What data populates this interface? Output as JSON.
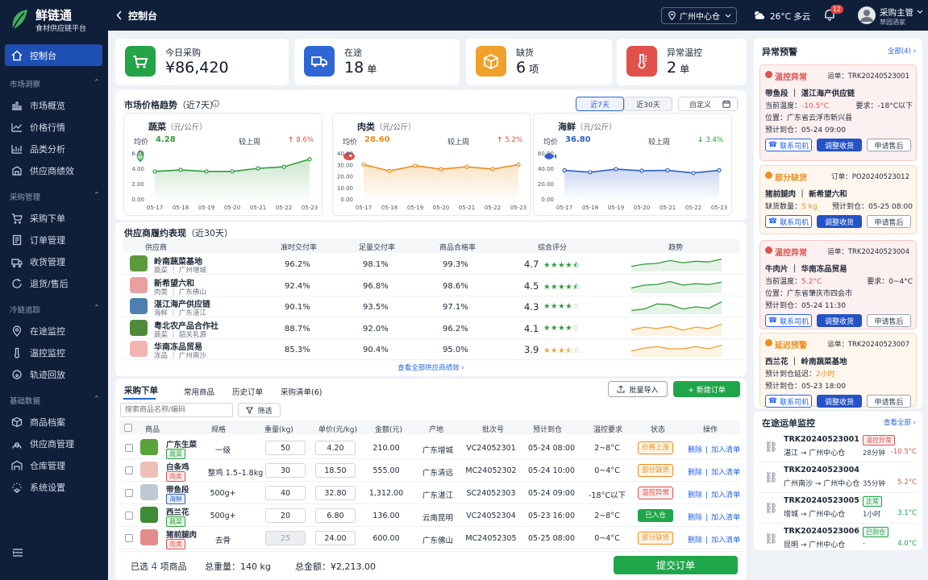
{
  "app": {
    "name": "鲜链通",
    "subtitle": "食材供应链平台"
  },
  "topbar": {
    "page_title": "控制台",
    "location": "广州中心仓",
    "weather": "26°C 多云",
    "notif_count": "12",
    "user_name": "采购主管",
    "user_org": "草园酒家"
  },
  "sidebar": {
    "home": "控制台",
    "groups": [
      {
        "title": "市场洞察",
        "items": [
          "市场概览",
          "价格行情",
          "品类分析",
          "供应商绩效"
        ]
      },
      {
        "title": "采购管理",
        "items": [
          "采购下单",
          "订单管理",
          "收货管理",
          "退货/售后"
        ]
      },
      {
        "title": "冷链追踪",
        "items": [
          "在途监控",
          "温控监控",
          "轨迹回放"
        ]
      },
      {
        "title": "基础数据",
        "items": [
          "商品档案",
          "供应商管理",
          "仓库管理",
          "系统设置"
        ]
      }
    ]
  },
  "kpis": [
    {
      "label": "今日采购",
      "value": "¥86,420",
      "unit": ""
    },
    {
      "label": "在途",
      "value": "18",
      "unit": "单"
    },
    {
      "label": "缺货",
      "value": "6",
      "unit": "项"
    },
    {
      "label": "异常温控",
      "value": "2",
      "unit": "单"
    }
  ],
  "price_trend": {
    "title": "市场价格趋势",
    "subtitle": "（近7天）",
    "tabs": [
      "近7天",
      "近30天"
    ],
    "custom": "自定义",
    "avg_label": "均价",
    "cmp_label": "较上周",
    "charts": [
      {
        "name": "蔬菜",
        "unit": "（元/公斤）",
        "avg": "4.28",
        "change": "8.6%",
        "dir": "up",
        "color": "#2e9b3b"
      },
      {
        "name": "肉类",
        "unit": "（元/公斤）",
        "avg": "28.60",
        "change": "5.2%",
        "dir": "up",
        "color": "#f08c1a"
      },
      {
        "name": "海鲜",
        "unit": "（元/公斤）",
        "avg": "36.80",
        "change": "3.4%",
        "dir": "down",
        "color": "#2f5fc8"
      }
    ]
  },
  "chart_data": [
    {
      "type": "line",
      "title": "蔬菜",
      "x": [
        "05-17",
        "05-18",
        "05-19",
        "05-20",
        "05-21",
        "05-22",
        "05-23"
      ],
      "values": [
        3.6,
        3.8,
        3.6,
        3.6,
        4.0,
        4.2,
        5.2
      ],
      "ylim": [
        0,
        6
      ],
      "yticks": [
        "6.00",
        "4.00",
        "2.00",
        "0.00"
      ]
    },
    {
      "type": "line",
      "title": "肉类",
      "x": [
        "05-17",
        "05-18",
        "05-19",
        "05-20",
        "05-21",
        "05-22",
        "05-23"
      ],
      "values": [
        30,
        24.5,
        29,
        26,
        28,
        26,
        30
      ],
      "ylim": [
        0,
        40
      ],
      "yticks": [
        "40.00",
        "30.00",
        "20.00",
        "10.00",
        "0.00"
      ]
    },
    {
      "type": "line",
      "title": "海鲜",
      "x": [
        "05-17",
        "05-18",
        "05-19",
        "05-20",
        "05-21",
        "05-22",
        "05-23"
      ],
      "values": [
        37.5,
        35,
        39,
        37,
        37.5,
        34,
        37.5
      ],
      "ylim": [
        0,
        60
      ],
      "yticks": [
        "60.00",
        "40.00",
        "20.00",
        "0.00"
      ]
    }
  ],
  "supplier": {
    "title": "供应商履约表现",
    "subtitle": "（近30天）",
    "headers": [
      "供应商",
      "准时交付率",
      "足量交付率",
      "商品合格率",
      "综合评分",
      "趋势"
    ],
    "rows": [
      {
        "name": "岭南蔬菜基地",
        "sub": "蔬菜 ｜ 广州增城",
        "ontime": "96.2%",
        "full": "98.1%",
        "quality": "99.3%",
        "score": "4.7",
        "stars": 4.5,
        "trend": "up",
        "spark": [
          0.3,
          0.45,
          0.5,
          0.7,
          0.55,
          0.65,
          0.6,
          0.8
        ]
      },
      {
        "name": "新希望六和",
        "sub": "肉类 ｜ 广东佛山",
        "ontime": "92.4%",
        "full": "96.8%",
        "quality": "98.6%",
        "score": "4.5",
        "stars": 4.5,
        "trend": "up",
        "spark": [
          0.3,
          0.5,
          0.55,
          0.75,
          0.5,
          0.6,
          0.55,
          0.7
        ]
      },
      {
        "name": "湛江海产供应链",
        "sub": "海鲜 ｜ 广东湛江",
        "ontime": "90.1%",
        "full": "93.5%",
        "quality": "97.1%",
        "score": "4.3",
        "stars": 4,
        "trend": "up",
        "spark": [
          0.2,
          0.3,
          0.65,
          0.6,
          0.3,
          0.45,
          0.35,
          0.8
        ]
      },
      {
        "name": "粤北农产品合作社",
        "sub": "蔬菜 ｜ 韶关乳源",
        "ontime": "88.7%",
        "full": "92.0%",
        "quality": "96.2%",
        "score": "4.1",
        "stars": 4,
        "trend": "down",
        "spark": [
          0.35,
          0.55,
          0.45,
          0.6,
          0.35,
          0.55,
          0.45,
          0.75
        ]
      },
      {
        "name": "华南冻品贸易",
        "sub": "冻品 ｜ 广州南沙",
        "ontime": "85.3%",
        "full": "90.4%",
        "quality": "95.0%",
        "score": "3.9",
        "stars": 3.5,
        "trend": "down",
        "spark": [
          0.35,
          0.55,
          0.65,
          0.5,
          0.5,
          0.65,
          0.5,
          0.75
        ]
      }
    ],
    "view_all": "查看全部供应商绩效 ›"
  },
  "order": {
    "tabs": [
      "采购下单",
      "常用商品",
      "历史订单",
      "采购清单(6)"
    ],
    "batch_import": "批量导入",
    "new_order": "+ 新建订单",
    "search_placeholder": "搜索商品名称/编码",
    "filter": "筛选",
    "headers": [
      "商品",
      "规格",
      "重量(kg)",
      "单价(元/kg)",
      "金额(元)",
      "产地",
      "批次号",
      "预计到仓",
      "温控要求",
      "状态",
      "操作"
    ],
    "op_delete": "删除",
    "op_add": "加入清单",
    "rows": [
      {
        "name": "广东生菜",
        "cat": "蔬菜",
        "spec": "一级",
        "weight": "50",
        "price": "4.20",
        "amount": "210.00",
        "origin": "广东增城",
        "batch": "VC24052301",
        "eta": "05-24 08:00",
        "temp": "2~8°C",
        "status": "价格上涨"
      },
      {
        "name": "白条鸡",
        "cat": "肉类",
        "spec": "整鸡 1.5–1.8kg",
        "weight": "30",
        "price": "18.50",
        "amount": "555.00",
        "origin": "广东清远",
        "batch": "MC24052302",
        "eta": "05-24 10:00",
        "temp": "0~4°C",
        "status": "部分缺货"
      },
      {
        "name": "带鱼段",
        "cat": "海鲜",
        "spec": "500g+",
        "weight": "40",
        "price": "32.80",
        "amount": "1,312.00",
        "origin": "广东湛江",
        "batch": "SC24052303",
        "eta": "05-24 09:00",
        "temp": "-18°C以下",
        "status": "温控异常"
      },
      {
        "name": "西兰花",
        "cat": "蔬菜",
        "spec": "500g+",
        "weight": "20",
        "price": "6.80",
        "amount": "136.00",
        "origin": "云南昆明",
        "batch": "VC24052304",
        "eta": "05-23 16:00",
        "temp": "2~8°C",
        "status": "已入仓"
      },
      {
        "name": "猪前腿肉",
        "cat": "肉类",
        "spec": "去骨",
        "weight": "25",
        "price": "24.00",
        "amount": "600.00",
        "origin": "广东佛山",
        "batch": "MC24052305",
        "eta": "05-25 08:00",
        "temp": "0~4°C",
        "status": "部分缺货"
      }
    ],
    "footer": {
      "selected_prefix": "已选",
      "selected_count": "4",
      "selected_suffix": "项商品",
      "weight_label": "总重量：",
      "weight": "140 kg",
      "amount_label": "总金额：",
      "amount": "¥2,213.00",
      "submit": "提交订单"
    }
  },
  "alerts": {
    "title": "异常预警",
    "all": "全部(4) ›",
    "btn_contact": "联系司机",
    "btn_adjust": "调整收货",
    "btn_after": "申请售后",
    "items": [
      {
        "type": "温控异常",
        "no_label": "运单：",
        "no": "TRK20240523001",
        "product": "带鱼段 ｜ 湛江海产供应链",
        "l1a": "当前温度：",
        "l1v": "-10.5°C",
        "l1b": "要求：-18°C以下",
        "l2": "位置：广东省云浮市新兴县",
        "l3": "预计到仓：05-24 09:00"
      },
      {
        "type": "部分缺货",
        "no_label": "订单：",
        "no": "PO20240523012",
        "product": "猪前腿肉 ｜ 新希望六和",
        "l1a": "缺货数量：",
        "l1v": "5 kg",
        "l1b": "预计到仓：05-25 08:00"
      },
      {
        "type": "温控异常",
        "no_label": "运单：",
        "no": "TRK20240523004",
        "product": "牛肉片 ｜ 华南冻品贸易",
        "l1a": "当前温度：",
        "l1v": "5.2°C",
        "l1b": "要求：0~4°C",
        "l2": "位置：广东省肇庆市四会市",
        "l3": "预计到仓：05-24 11:30"
      },
      {
        "type": "延迟预警",
        "no_label": "运单：",
        "no": "TRK20240523007",
        "product": "西兰花 ｜ 岭南蔬菜基地",
        "l1a": "预计到仓延迟：",
        "l1v": "2小时",
        "l2": "预计到仓：05-23 18:00"
      }
    ]
  },
  "transit": {
    "title": "在途运单监控",
    "all": "查看全部 ›",
    "items": [
      {
        "no": "TRK20240523001",
        "route": "湛江 → 广州中心仓",
        "status": "温控异常",
        "time": "28分钟",
        "temp": "-10.5°C"
      },
      {
        "no": "TRK20240523004",
        "route": "广州南沙 → 广州中心仓",
        "status": "",
        "time": "35分钟",
        "temp": "5.2°C"
      },
      {
        "no": "TRK20240523005",
        "route": "增城 → 广州中心仓",
        "status": "正常",
        "time": "1小时",
        "temp": "3.1°C"
      },
      {
        "no": "TRK20240523006",
        "route": "昆明 → 广州中心仓",
        "status": "已到仓",
        "time": "-",
        "temp": "4.0°C"
      }
    ]
  }
}
